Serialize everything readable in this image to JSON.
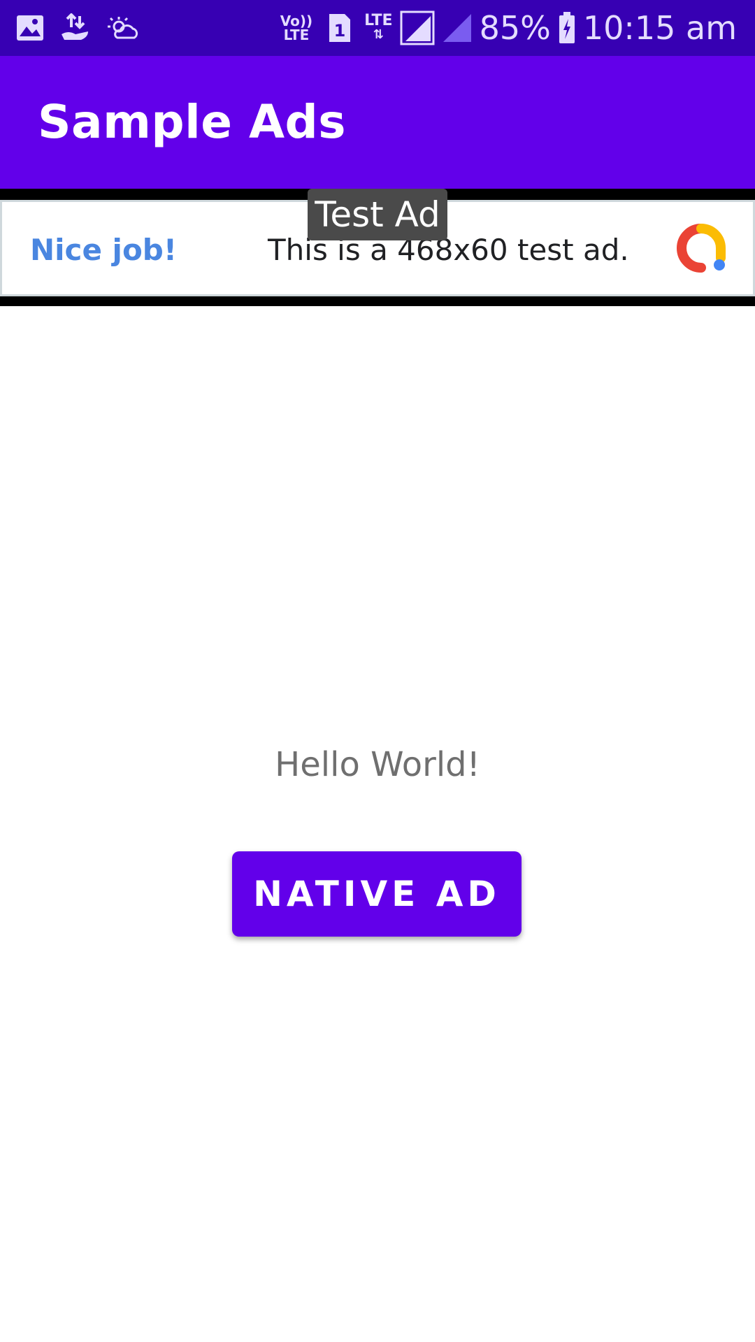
{
  "status_bar": {
    "icons_left": [
      "image-icon",
      "data-transfer-icon",
      "weather-icon"
    ],
    "volte_top": "Vo))",
    "volte_bottom": "LTE",
    "sim_number": "1",
    "lte_label": "LTE",
    "battery_percent": "85%",
    "time": "10:15 am"
  },
  "app_bar": {
    "title": "Sample Ads",
    "color": "#6200ea"
  },
  "banner_ad": {
    "headline": "Nice job!",
    "body": "This is a 468x60 test ad.",
    "badge": "Test Ad",
    "logo_icon": "google-ads-logo-icon"
  },
  "main": {
    "greeting": "Hello World!",
    "native_ad_button": "NATIVE AD"
  }
}
